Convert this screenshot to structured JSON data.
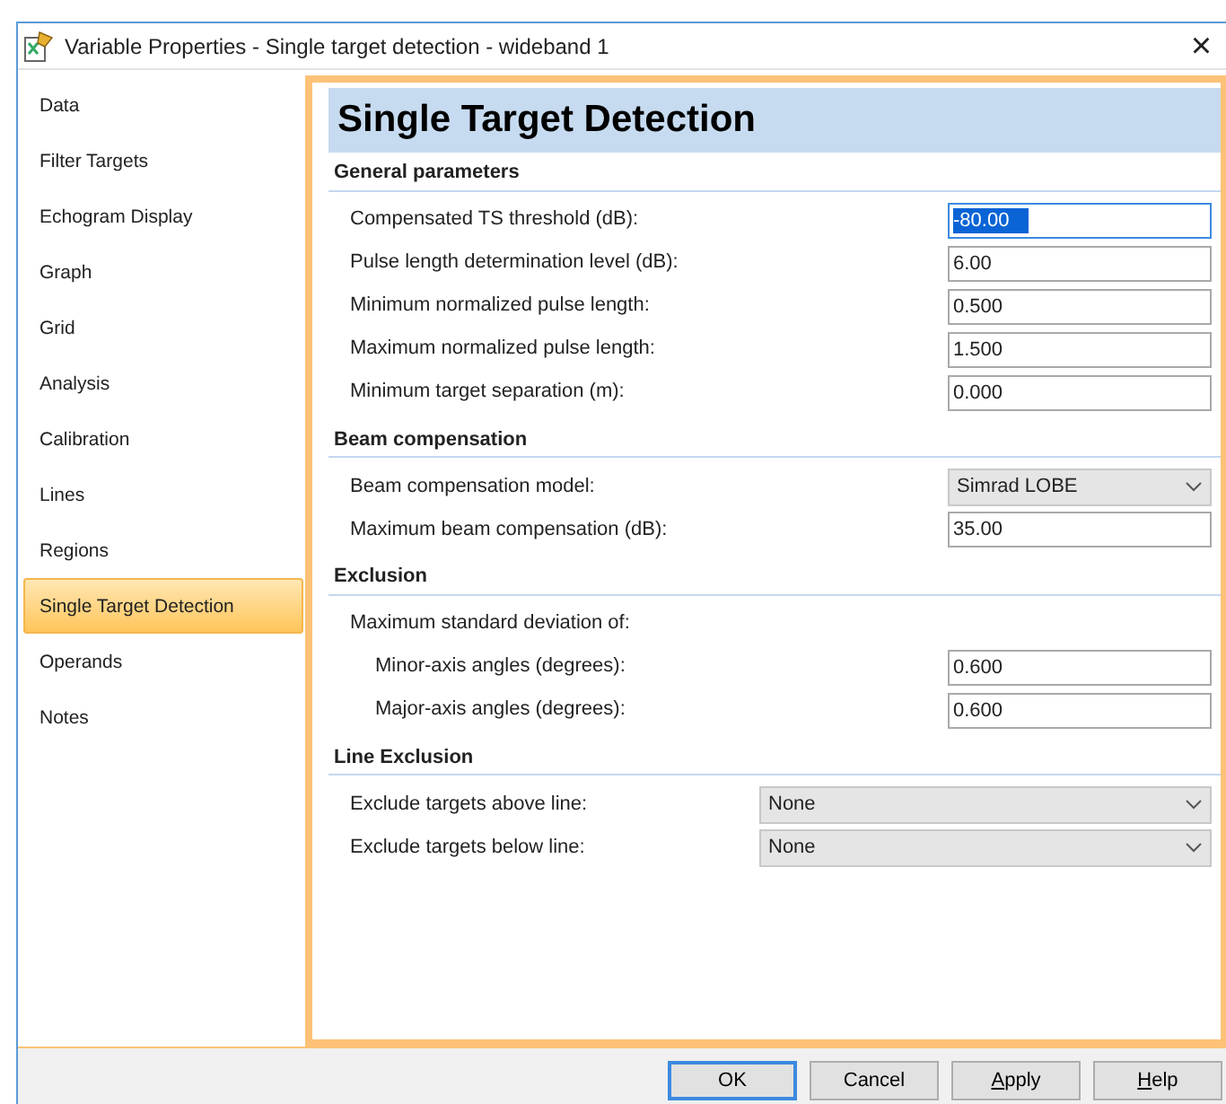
{
  "window": {
    "title": "Variable Properties - Single target detection - wideband 1",
    "close": "×"
  },
  "sidebar": {
    "items": [
      {
        "label": "Data",
        "selected": false
      },
      {
        "label": "Filter Targets",
        "selected": false
      },
      {
        "label": "Echogram Display",
        "selected": false
      },
      {
        "label": "Graph",
        "selected": false
      },
      {
        "label": "Grid",
        "selected": false
      },
      {
        "label": "Analysis",
        "selected": false
      },
      {
        "label": "Calibration",
        "selected": false
      },
      {
        "label": "Lines",
        "selected": false
      },
      {
        "label": "Regions",
        "selected": false
      },
      {
        "label": "Single Target Detection",
        "selected": true
      },
      {
        "label": "Operands",
        "selected": false
      },
      {
        "label": "Notes",
        "selected": false
      }
    ]
  },
  "page": {
    "title": "Single Target Detection",
    "sections": [
      {
        "heading": "General parameters",
        "rows": [
          {
            "kind": "text",
            "label": "Compensated TS threshold (dB):",
            "value": "-80.00",
            "selected": true
          },
          {
            "kind": "text",
            "label": "Pulse length determination level (dB):",
            "value": "6.00",
            "selected": false
          },
          {
            "kind": "text",
            "label": "Minimum normalized pulse length:",
            "value": "0.500",
            "selected": false
          },
          {
            "kind": "text",
            "label": "Maximum normalized pulse length:",
            "value": "1.500",
            "selected": false
          },
          {
            "kind": "text",
            "label": "Minimum target separation (m):",
            "value": "0.000",
            "selected": false
          }
        ]
      },
      {
        "heading": "Beam compensation",
        "rows": [
          {
            "kind": "select",
            "label": "Beam compensation model:",
            "value": "Simrad LOBE"
          },
          {
            "kind": "text",
            "label": "Maximum beam compensation (dB):",
            "value": "35.00",
            "selected": false
          }
        ]
      },
      {
        "heading": "Exclusion",
        "rows": [
          {
            "kind": "note",
            "label": "Maximum standard deviation of:"
          },
          {
            "kind": "subtext",
            "label": "Minor-axis angles (degrees):",
            "value": "0.600",
            "selected": false
          },
          {
            "kind": "subtext",
            "label": "Major-axis angles (degrees):",
            "value": "0.600",
            "selected": false
          }
        ]
      },
      {
        "heading": "Line Exclusion",
        "rows": [
          {
            "kind": "wideselect",
            "label": "Exclude targets above line:",
            "value": "None"
          },
          {
            "kind": "wideselect",
            "label": "Exclude targets below line:",
            "value": "None"
          }
        ]
      }
    ]
  },
  "buttons": [
    {
      "label": "OK",
      "default": true,
      "mnemonic_underlined": false
    },
    {
      "label": "Cancel",
      "default": false,
      "mnemonic_underlined": false
    },
    {
      "label": "Apply",
      "default": false,
      "mnemonic_underlined": true
    },
    {
      "label": "Help",
      "default": false,
      "mnemonic_underlined": true
    }
  ]
}
